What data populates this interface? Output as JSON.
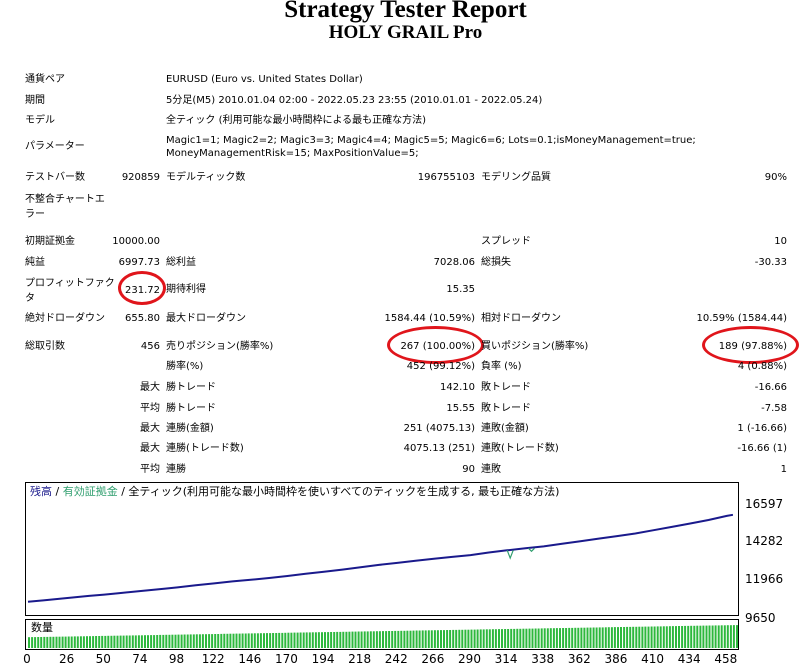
{
  "report": {
    "title": "Strategy Tester Report",
    "subtitle": "HOLY GRAIL Pro"
  },
  "info": {
    "symbol_label": "通貨ペア",
    "symbol_value": "EURUSD (Euro vs. United States Dollar)",
    "period_label": "期間",
    "period_value": "5分足(M5) 2010.01.04 02:00 - 2022.05.23 23:55 (2010.01.01 - 2022.05.24)",
    "model_label": "モデル",
    "model_value": "全ティック (利用可能な最小時間枠による最も正確な方法)",
    "params_label": "パラメーター",
    "params_value": "Magic1=1; Magic2=2; Magic3=3; Magic4=4; Magic5=5; Magic6=6; Lots=0.1;isMoneyManagement=true; MoneyManagementRisk=15; MaxPositionValue=5;"
  },
  "stats": {
    "bars_label": "テストバー数",
    "bars_value": "920859",
    "ticks_label": "モデルティック数",
    "ticks_value": "196755103",
    "quality_label": "モデリング品質",
    "quality_value": "90%",
    "mismatch_label": "不整合チャートエラー",
    "deposit_label": "初期証拠金",
    "deposit_value": "10000.00",
    "spread_label": "スプレッド",
    "spread_value": "10",
    "net_label": "純益",
    "net_value": "6997.73",
    "gross_profit_label": "総利益",
    "gross_profit_value": "7028.06",
    "gross_loss_label": "総損失",
    "gross_loss_value": "-30.33",
    "pf_label": "プロフィットファクタ",
    "pf_value": "231.72",
    "expected_label": "期待利得",
    "expected_value": "15.35",
    "abs_dd_label": "絶対ドローダウン",
    "abs_dd_value": "655.80",
    "max_dd_label": "最大ドローダウン",
    "max_dd_value": "1584.44 (10.59%)",
    "rel_dd_label": "相対ドローダウン",
    "rel_dd_value": "10.59% (1584.44)",
    "trades_label": "総取引数",
    "trades_value": "456",
    "short_label": "売りポジション(勝率%)",
    "short_value": "267 (100.00%)",
    "long_label": "買いポジション(勝率%)",
    "long_value": "189 (97.88%)",
    "winrate_label": "勝率(%)",
    "winrate_value": "452 (99.12%)",
    "lossrate_label": "負率 (%)",
    "lossrate_value": "4 (0.88%)",
    "max_label": "最大",
    "avg_label": "平均",
    "largest_win_label": "勝トレード",
    "largest_win_value": "142.10",
    "largest_loss_label": "敗トレード",
    "largest_loss_value": "-16.66",
    "avg_win_label": "勝トレード",
    "avg_win_value": "15.55",
    "avg_loss_label": "敗トレード",
    "avg_loss_value": "-7.58",
    "max_consec_wins_label": "連勝(金額)",
    "max_consec_wins_value": "251 (4075.13)",
    "max_consec_losses_label": "連敗(金額)",
    "max_consec_losses_value": "1 (-16.66)",
    "max_consec_profit_label": "連勝(トレード数)",
    "max_consec_profit_value": "4075.13 (251)",
    "max_consec_loss_label": "連敗(トレード数)",
    "max_consec_loss_value": "-16.66 (1)",
    "avg_consec_wins_label": "連勝",
    "avg_consec_wins_value": "90",
    "avg_consec_losses_label": "連敗",
    "avg_consec_losses_value": "1"
  },
  "chart": {
    "legend_balance": "残高",
    "legend_sep1": " / ",
    "legend_equity": "有効証拠金",
    "legend_sep2": " / ",
    "legend_model": "全ティック(利用可能な最小時間枠を使いすべてのティックを生成する, 最も正確な方法)",
    "volume_label": "数量",
    "colors": {
      "balance": "#1a1a8c",
      "equity": "#2f9e6e",
      "volume": "#2db83d",
      "highlight": "#e0151b"
    }
  },
  "chart_data": {
    "type": "line",
    "y_ticks": [
      "16597",
      "14282",
      "11966",
      "9650"
    ],
    "ylim": [
      9650,
      17000
    ],
    "x_ticks": [
      "0",
      "26",
      "50",
      "74",
      "98",
      "122",
      "146",
      "170",
      "194",
      "218",
      "242",
      "266",
      "290",
      "314",
      "338",
      "362",
      "386",
      "410",
      "434",
      "458"
    ],
    "xlim": [
      0,
      464
    ],
    "series": [
      {
        "x": [
          0,
          10,
          20,
          30,
          40,
          50,
          60,
          74,
          90,
          98,
          110,
          122,
          134,
          146,
          158,
          170,
          182,
          194,
          206,
          218,
          230,
          242,
          254,
          266,
          278,
          290,
          302,
          314,
          326,
          338,
          350,
          362,
          374,
          386,
          398,
          410,
          422,
          434,
          446,
          458,
          462
        ],
        "y": [
          10000,
          10090,
          10190,
          10290,
          10390,
          10480,
          10580,
          10720,
          10880,
          10960,
          11100,
          11230,
          11360,
          11470,
          11590,
          11720,
          11870,
          12010,
          12150,
          12300,
          12460,
          12600,
          12740,
          12870,
          13000,
          13120,
          13290,
          13440,
          13570,
          13700,
          13870,
          14040,
          14220,
          14390,
          14560,
          14780,
          15000,
          15230,
          15460,
          15740,
          15810
        ]
      }
    ],
    "volume_min": 0.4,
    "volume_max": 0.85
  }
}
